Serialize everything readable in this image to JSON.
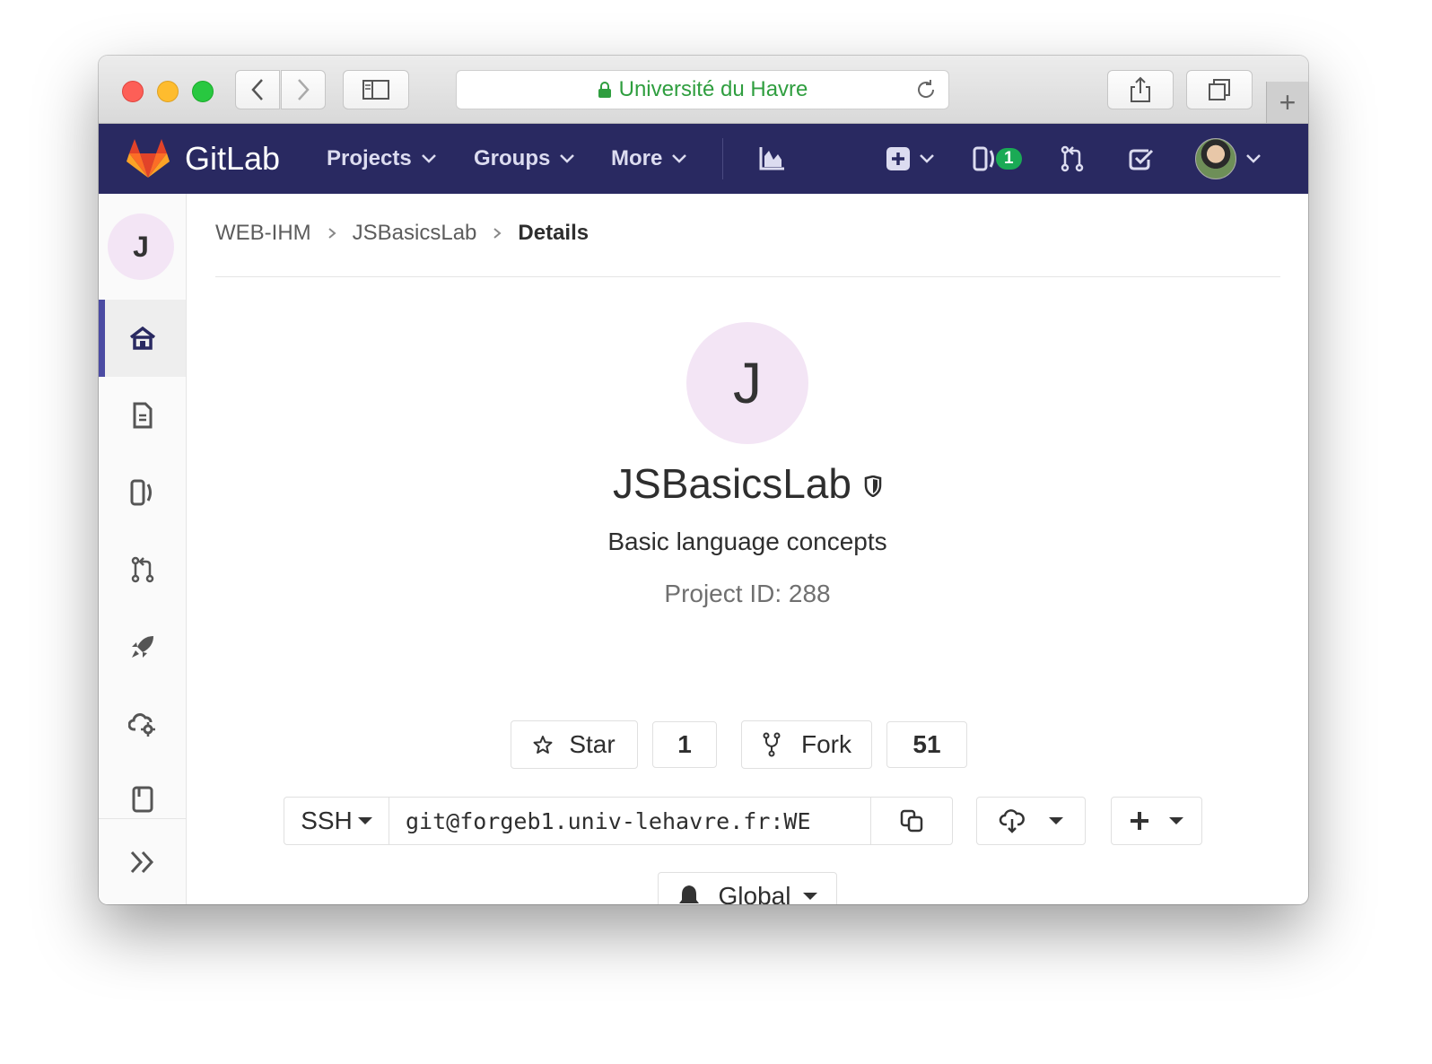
{
  "browser": {
    "url_text": "Université du Havre",
    "new_tab_label": "+"
  },
  "navbar": {
    "brand": "GitLab",
    "projects_label": "Projects",
    "groups_label": "Groups",
    "more_label": "More",
    "issues_count": "1"
  },
  "sidebar": {
    "project_avatar_letter": "J",
    "items": [
      "home-icon",
      "file-icon",
      "issues-icon",
      "merge-request-icon",
      "rocket-icon",
      "cloud-gear-icon",
      "book-icon"
    ],
    "active_item": "home-icon"
  },
  "breadcrumb": {
    "items": [
      "WEB-IHM",
      "JSBasicsLab",
      "Details"
    ]
  },
  "project": {
    "avatar_letter": "J",
    "name": "JSBasicsLab",
    "description": "Basic language concepts",
    "id_text": "Project ID: 288"
  },
  "actions": {
    "star_label": "Star",
    "star_count": "1",
    "fork_label": "Fork",
    "fork_count": "51",
    "protocol_label": "SSH",
    "clone_url": "git@forgeb1.univ-lehavre.fr:WE",
    "notification_label": "Global"
  },
  "colors": {
    "navbar_bg": "#292961",
    "active_accent": "#4b4ba3",
    "avatar_bg": "#f3e5f5",
    "badge_green": "#1aaa55",
    "url_green": "#2f9e3f"
  }
}
